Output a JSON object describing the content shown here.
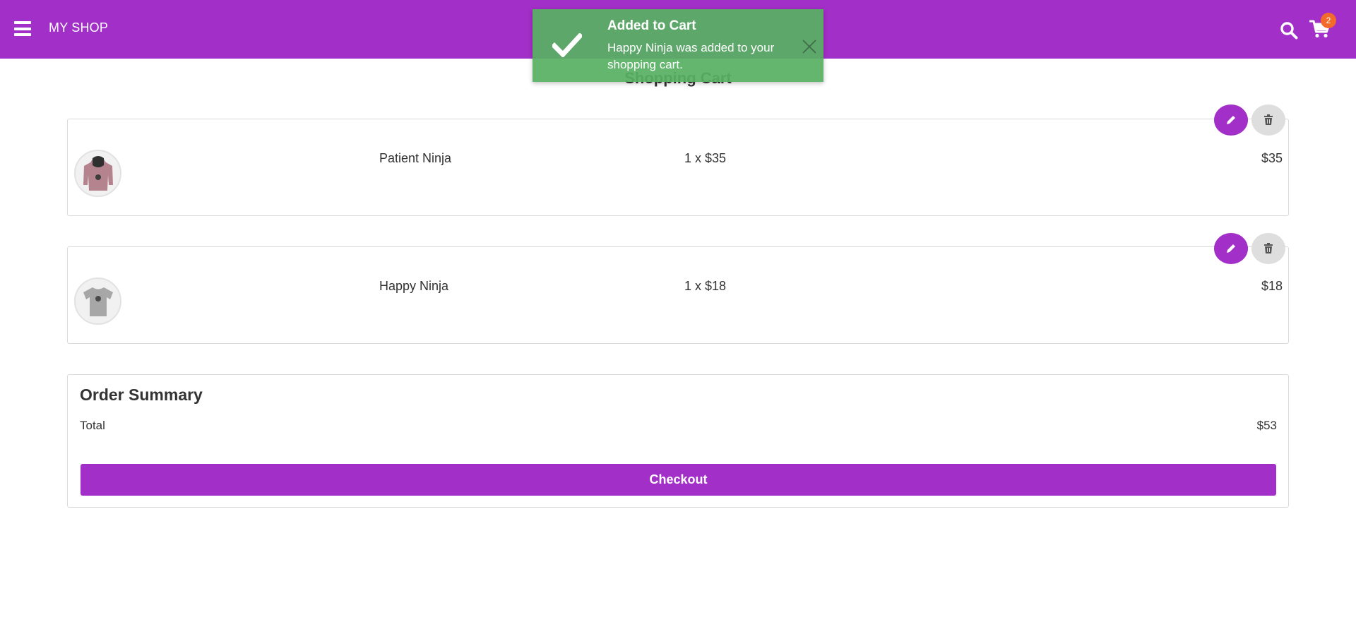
{
  "header": {
    "brand": "MY SHOP",
    "cart_count": "2",
    "background_color": "#a22fc7",
    "badge_color": "#f36b2b",
    "icons": [
      "menu-icon",
      "search-icon",
      "cart-icon"
    ]
  },
  "toast": {
    "title": "Added to Cart",
    "message": "Happy Ninja was added to your shopping cart.",
    "color": "#58b064",
    "icons": [
      "checkmark-icon",
      "close-icon"
    ]
  },
  "page": {
    "title": "Shopping Cart"
  },
  "cart": {
    "items": [
      {
        "name": "Patient Ninja",
        "quantity_price": "1 x $35",
        "total": "$35",
        "thumbnail": "hoodie"
      },
      {
        "name": "Happy Ninja",
        "quantity_price": "1 x $18",
        "total": "$18",
        "thumbnail": "t-shirt"
      }
    ],
    "item_icons": [
      "pencil-icon",
      "trash-icon"
    ]
  },
  "summary": {
    "title": "Order Summary",
    "total_label": "Total",
    "total_value": "$53",
    "checkout_label": "Checkout"
  }
}
